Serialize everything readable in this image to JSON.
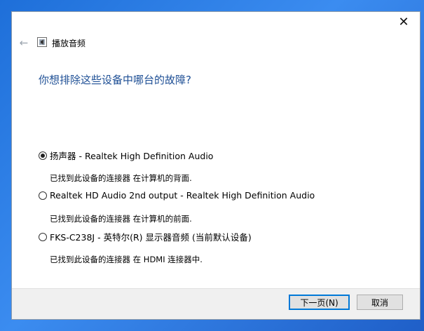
{
  "window": {
    "title": "播放音频",
    "question": "你想排除这些设备中哪台的故障?"
  },
  "options": [
    {
      "label": "扬声器 - Realtek High Definition Audio",
      "desc": "已找到此设备的连接器 在计算机的背面.",
      "checked": true
    },
    {
      "label": "Realtek HD Audio 2nd output - Realtek High Definition Audio",
      "desc": "已找到此设备的连接器 在计算机的前面.",
      "checked": false
    },
    {
      "label": "FKS-C238J - 英特尔(R) 显示器音频 (当前默认设备)",
      "desc": "已找到此设备的连接器 在 HDMI 连接器中.",
      "checked": false
    }
  ],
  "buttons": {
    "next": "下一页(N)",
    "cancel": "取消"
  },
  "icons": {
    "close": "close-icon",
    "back": "back-arrow-icon",
    "app": "audio-troubleshooter-icon"
  }
}
